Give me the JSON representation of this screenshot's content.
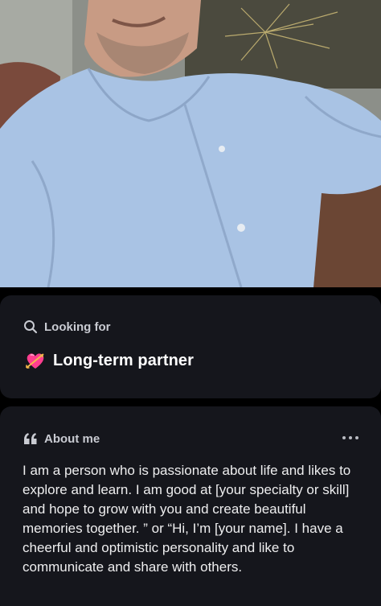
{
  "photo": {
    "alt": "profile photo",
    "colors": {
      "shirt": "#a9c3e4",
      "skin": "#c89b84",
      "background": "#8c8f89"
    }
  },
  "looking_for": {
    "header_icon": "search-icon",
    "header_label": "Looking for",
    "value_icon": "heart-with-arrow-icon",
    "value": "Long-term partner"
  },
  "about_me": {
    "header_icon": "quote-icon",
    "header_label": "About me",
    "more_icon": "more-horizontal-icon",
    "text": "I am a person who is passionate about life and likes to explore and learn. I am good at [your specialty or skill] and hope to grow with you and create beautiful memories together. ” or “Hi, I’m [your name]. I have a cheerful and optimistic personality and like to communicate and share with others."
  },
  "colors": {
    "page_background": "#000000",
    "card_background": "#15161c",
    "label_gray": "#c9cbd2",
    "text_white": "#ffffff"
  }
}
